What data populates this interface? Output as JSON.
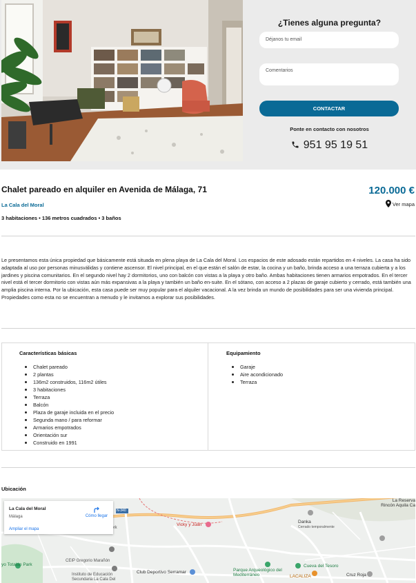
{
  "contact": {
    "title": "¿Tienes alguna pregunta?",
    "email_placeholder": "Déjanos tu email",
    "comments_placeholder": "Comentarios",
    "button_label": "CONTACTAR",
    "subtitle": "Ponte en contacto con nosotros",
    "phone": "951 95 19 51",
    "phone_icon": "phone-icon"
  },
  "listing": {
    "title": "Chalet pareado en alquiler en Avenida de Málaga, 71",
    "price": "120.000 €",
    "area": "La Cala del Moral",
    "map_link": "Ver mapa",
    "summary": "3 habitaciones • 136 metros cuadrados • 3 baños",
    "description": "Le presentamos esta única propiedad que básicamente está situada en plena playa de La Cala del Moral. Los espacios de este adosado están repartidos en 4 niveles. La casa ha sido adaptada al uso por personas minusválidas y contiene ascensor. El nivel principal, en el que están el salón de estar, la cocina y un baño, brinda acceso a una terraza cubierta y a los jardines y piscina comunitarios. En el segundo nivel hay 2 dormitorios, uno con balcón con vistas a la playa y otro baño. Ambas habitaciones tienen armarios empotrados. En el tercer nivel está el tercer dormitorio con vistas aún más expansivas a la playa y también un baño en-suite. En el sótano, con acceso a 2 plazas de garaje cubierto y cerrado, está también una amplia piscina interna. Por la ubicación, esta casa puede ser muy popular para el alquiler vacacional. A la vez brinda un mundo de posibilidades para ser una vivienda principal. Propiedades como esta no se encuentran a menudo y le invitamos a explorar sus posibilidades."
  },
  "characteristics": {
    "basic_title": "Características básicas",
    "basic": [
      "Chalet pareado",
      "2 plantas",
      "136m2 construidos, 116m2 útiles",
      "3 habitaciones",
      "Terraza",
      "Balcón",
      "Plaza de garaje incluida en el precio",
      "Segunda mano / para reformar",
      "Armarios empotrados",
      "Orientación sur",
      "Construido en 1991"
    ],
    "equip_title": "Equipamiento",
    "equipment": [
      "Garaje",
      "Aire acondicionado",
      "Terraza"
    ]
  },
  "location": {
    "title": "Ubicación",
    "card_place": "La Cala del Moral",
    "card_city": "Málaga",
    "card_directions": "Cómo llegar",
    "card_enlarge": "Ampliar el mapa",
    "labels": {
      "network": "etwork",
      "vicky": "Vicky y Juan",
      "danka": "Danka",
      "danka_sub": "Cerrado temporalmente",
      "ceip": "CEIP Gregorio Marañón",
      "instituto": "Instituto de Educación Secundaria La Cala Del",
      "club": "Club Deportivo Serramar",
      "parque": "Parque Arqueológico del Mediterráneo",
      "cueva": "Cueva del Tesoro",
      "lacaliza": "LACALIZA",
      "cruz": "Cruz Roja",
      "reserva": "La Reserva Rincón Aquila Ca",
      "park": "yo Totalán Park",
      "road": "N-340"
    }
  },
  "colors": {
    "accent": "#0a6a96",
    "contact_bg": "#ebebeb"
  }
}
